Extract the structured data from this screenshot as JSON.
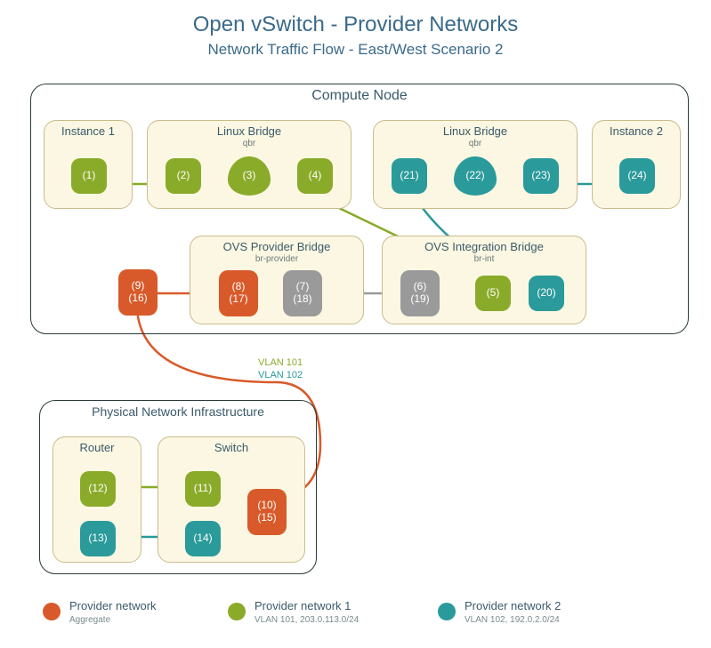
{
  "title": "Open vSwitch - Provider Networks",
  "subtitle": "Network Traffic Flow - East/West Scenario 2",
  "compute": {
    "label": "Compute Node",
    "instance1": {
      "label": "Instance 1",
      "n1": "(1)"
    },
    "lb1": {
      "label": "Linux Bridge",
      "sub": "qbr",
      "n2": "(2)",
      "n3": "(3)",
      "n4": "(4)"
    },
    "lb2": {
      "label": "Linux Bridge",
      "sub": "qbr",
      "n21": "(21)",
      "n22": "(22)",
      "n23": "(23)"
    },
    "instance2": {
      "label": "Instance 2",
      "n24": "(24)"
    },
    "ovs_prov": {
      "label": "OVS Provider Bridge",
      "sub": "br-provider",
      "n8top": "(8)",
      "n8bot": "(17)",
      "n7top": "(7)",
      "n7bot": "(18)"
    },
    "n9top": "(9)",
    "n9bot": "(16)",
    "ovs_int": {
      "label": "OVS Integration Bridge",
      "sub": "br-int",
      "n6top": "(6)",
      "n6bot": "(19)",
      "n5": "(5)",
      "n20": "(20)"
    }
  },
  "phys": {
    "label": "Physical Network Infrastructure",
    "router": {
      "label": "Router",
      "n12": "(12)",
      "n13": "(13)"
    },
    "switch": {
      "label": "Switch",
      "n11": "(11)",
      "n14": "(14)",
      "n10top": "(10)",
      "n10bot": "(15)"
    }
  },
  "vlan101": "VLAN 101",
  "vlan102": "VLAN 102",
  "legend": {
    "agg": {
      "title": "Provider network",
      "sub": "Aggregate"
    },
    "net1": {
      "title": "Provider network 1",
      "sub": "VLAN 101, 203.0.113.0/24"
    },
    "net2": {
      "title": "Provider network 2",
      "sub": "VLAN 102, 192.0.2.0/24"
    }
  }
}
